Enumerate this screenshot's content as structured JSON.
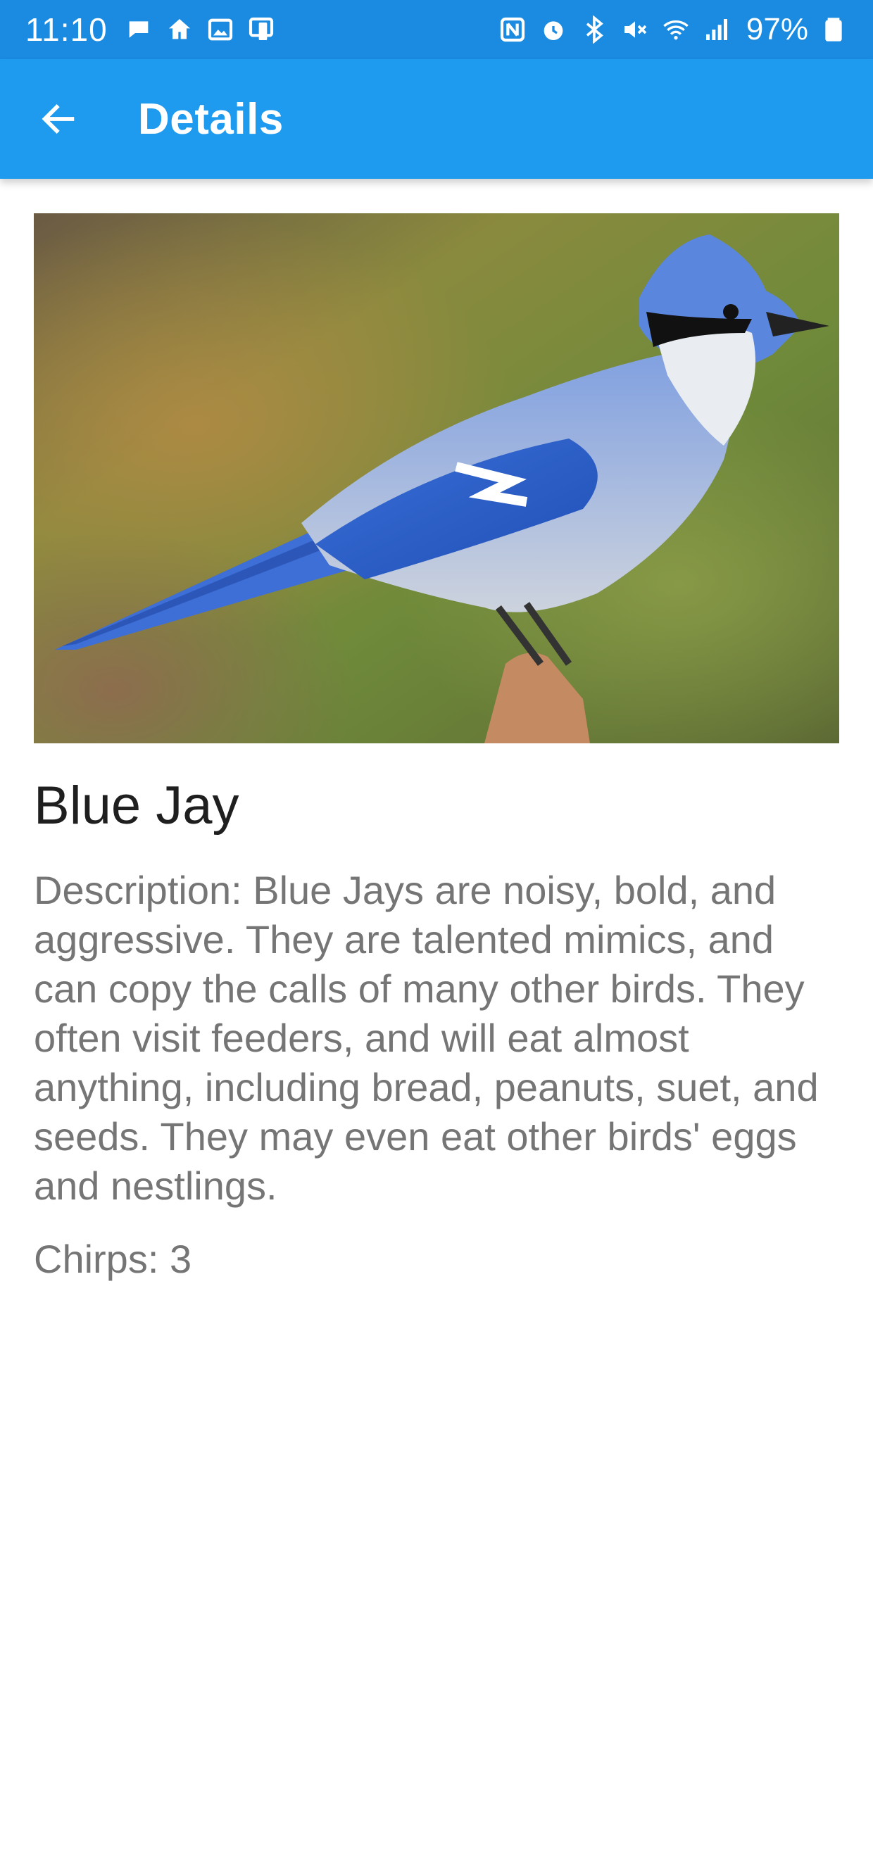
{
  "status_bar": {
    "time": "11:10",
    "battery": "97%",
    "left_icons": [
      "chat-bubble-icon",
      "home-icon",
      "gallery-icon",
      "device-icon"
    ],
    "right_icons": [
      "nfc-icon",
      "alarm-icon",
      "bluetooth-icon",
      "mute-icon",
      "wifi-icon",
      "signal-icon",
      "battery-icon"
    ],
    "color": "#1a8be0"
  },
  "app_bar": {
    "title": "Details",
    "back_icon": "arrow-left-icon",
    "color": "#1e9bef"
  },
  "bird": {
    "name": "Blue Jay",
    "description": "Description: Blue Jays are noisy, bold, and aggressive. They are talented mimics, and can copy the calls of many other birds. They often visit feeders, and will eat almost anything, including bread, peanuts, suet, and seeds. They may even eat other birds' eggs and nestlings.",
    "chirps": "Chirps: 3"
  }
}
